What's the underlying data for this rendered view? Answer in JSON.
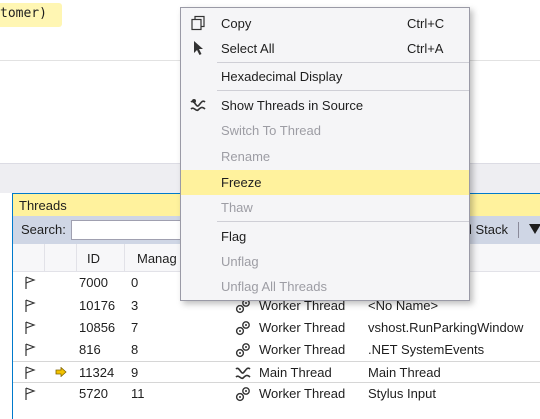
{
  "editor": {
    "code_fragment": "tomer)"
  },
  "threads_window": {
    "title": "Threads",
    "search_label": "Search:",
    "search_value": "",
    "stack_label": "l Stack",
    "columns": [
      "ID",
      "Manag"
    ],
    "rows": [
      {
        "id": "7000",
        "managed": "0",
        "category": "",
        "name": "",
        "current": false
      },
      {
        "id": "10176",
        "managed": "3",
        "category": "Worker Thread",
        "name": "<No Name>",
        "current": false
      },
      {
        "id": "10856",
        "managed": "7",
        "category": "Worker Thread",
        "name": "vshost.RunParkingWindow",
        "current": false
      },
      {
        "id": "816",
        "managed": "8",
        "category": "Worker Thread",
        "name": ".NET SystemEvents",
        "current": false
      },
      {
        "id": "11324",
        "managed": "9",
        "category": "Main Thread",
        "name": "Main Thread",
        "current": true
      },
      {
        "id": "5720",
        "managed": "11",
        "category": "Worker Thread",
        "name": "Stylus Input",
        "current": false
      }
    ]
  },
  "context_menu": {
    "items": [
      {
        "label": "Copy",
        "shortcut": "Ctrl+C",
        "icon": "copy-icon",
        "enabled": true
      },
      {
        "label": "Select All",
        "shortcut": "Ctrl+A",
        "icon": "select-all-icon",
        "enabled": true
      },
      {
        "label": "Hexadecimal Display",
        "shortcut": "",
        "icon": "",
        "enabled": true
      },
      {
        "label": "Show Threads in Source",
        "shortcut": "",
        "icon": "threads-in-source-icon",
        "enabled": true
      },
      {
        "label": "Switch To Thread",
        "shortcut": "",
        "icon": "",
        "enabled": false
      },
      {
        "label": "Rename",
        "shortcut": "",
        "icon": "",
        "enabled": false
      },
      {
        "label": "Freeze",
        "shortcut": "",
        "icon": "",
        "enabled": true,
        "highlighted": true
      },
      {
        "label": "Thaw",
        "shortcut": "",
        "icon": "",
        "enabled": false
      },
      {
        "label": "Flag",
        "shortcut": "",
        "icon": "",
        "enabled": true
      },
      {
        "label": "Unflag",
        "shortcut": "",
        "icon": "",
        "enabled": false
      },
      {
        "label": "Unflag All Threads",
        "shortcut": "",
        "icon": "",
        "enabled": false
      }
    ]
  },
  "colors": {
    "highlight": "#fff29d",
    "toolbar": "#cfd6e5",
    "accent": "#007acc",
    "disabled_text": "#9d9da4"
  }
}
